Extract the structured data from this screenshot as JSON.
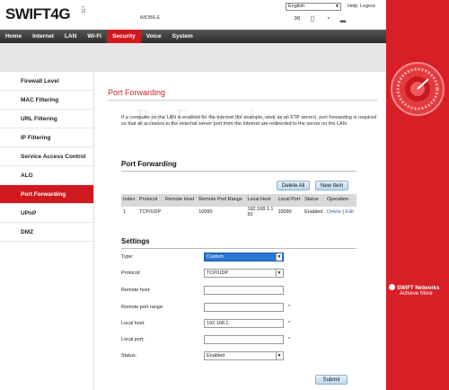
{
  "header": {
    "logo_text": "SWIFT4G",
    "logo_suffix": "LTE",
    "subtitle": "iMOBILE",
    "language": "English",
    "help": "Help",
    "logout": "Logout"
  },
  "status_icons": [
    "mail-icon",
    "sim-icon",
    "wifi-icon",
    "signal-icon"
  ],
  "nav": {
    "items": [
      {
        "label": "Home"
      },
      {
        "label": "Internet"
      },
      {
        "label": "LAN"
      },
      {
        "label": "Wi-Fi"
      },
      {
        "label": "Security",
        "active": true
      },
      {
        "label": "Voice"
      },
      {
        "label": "System"
      }
    ]
  },
  "sidebar": {
    "items": [
      {
        "label": "Firewall Level"
      },
      {
        "label": "MAC Filtering"
      },
      {
        "label": "URL Filtering"
      },
      {
        "label": "IP Filtering"
      },
      {
        "label": "Service Access Control"
      },
      {
        "label": "ALG"
      },
      {
        "label": "Port Forwarding",
        "active": true
      },
      {
        "label": "UPnP"
      },
      {
        "label": "DMZ"
      }
    ]
  },
  "main": {
    "title": "Port Forwarding",
    "watermark": "PortForward.com",
    "description": "If a computer on the LAN is enabled for the Internet (for example, work as an FTP server), port forwarding is required so that all accesses to the external server port from the Internet are redirected to the server on the LAN.",
    "pf_section_title": "Port Forwarding",
    "delete_all": "Delete All",
    "new_item": "New Item",
    "table": {
      "headers": [
        "Index",
        "Protocol",
        "Remote Host",
        "Remote Port Range",
        "Local Host",
        "Local Port",
        "Status",
        "Operation"
      ],
      "rows": [
        {
          "index": "1",
          "protocol": "TCP/UDP",
          "remote_host": "",
          "remote_port_range": "10090",
          "local_host": "192.168.1.150",
          "local_port": "10090",
          "status": "Enabled",
          "delete": "Delete",
          "sep": " | ",
          "edit": "Edit"
        }
      ]
    },
    "settings_title": "Settings",
    "form": {
      "type_label": "Type:",
      "type_value": "Custom",
      "protocol_label": "Protocol:",
      "protocol_value": "TCP/UDP",
      "remote_host_label": "Remote host:",
      "remote_host_value": "",
      "remote_port_label": "Remote port range:",
      "remote_port_value": "",
      "local_host_label": "Local host:",
      "local_host_value": "192.168.1.",
      "local_port_label": "Local port:",
      "local_port_value": "",
      "status_label": "Status:",
      "status_value": "Enabled",
      "required_mark": "*"
    },
    "submit": "Submit"
  },
  "brand_panel": {
    "line1": "SWIFT Networks",
    "line2": "Achieve More"
  },
  "colors": {
    "accent_red": "#d0191e",
    "side_red": "#d71f25",
    "nav_dark": "#3a3a3a"
  }
}
